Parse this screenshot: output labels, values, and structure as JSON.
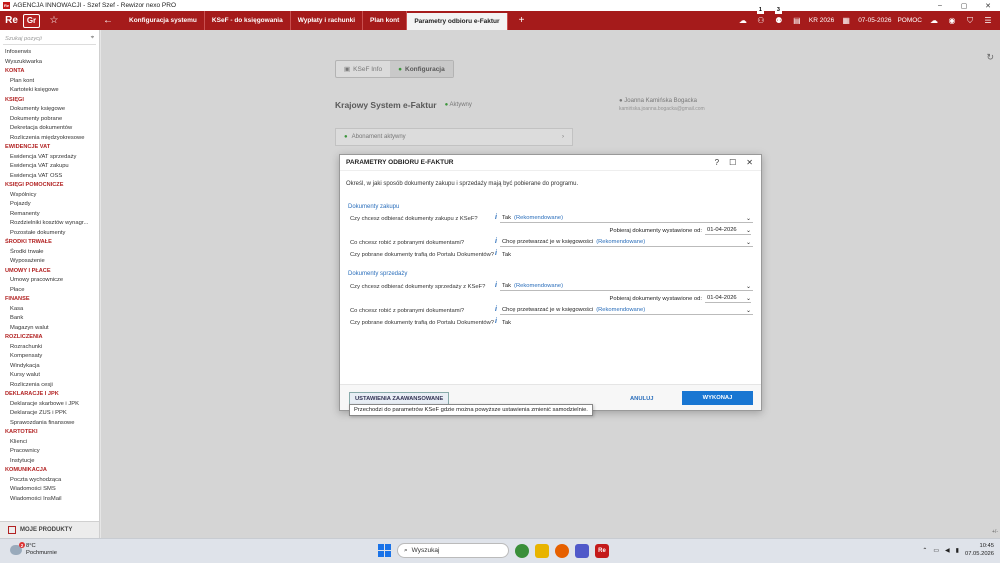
{
  "window": {
    "title": "AGENCJA INNOWACJI - Szef Szef - Rewizor nexo PRO",
    "icon_label": "Re",
    "minimize": "–",
    "maximize": "▢",
    "close": "✕"
  },
  "topbar": {
    "logo_re": "Re",
    "logo_gr": "Gr",
    "star": "☆",
    "back": "←",
    "tabs": [
      "Konfiguracja systemu",
      "KSeF - do księgowania",
      "Wypłaty i rachunki",
      "Plan kont",
      "Parametry odbioru e-Faktur"
    ],
    "active_tab_index": 4,
    "add_tab": "+",
    "badge1": "1",
    "badge2": "3",
    "year": "KR 2026",
    "date": "07-05-2026",
    "help": "POMOC",
    "menu_glyph": "☰"
  },
  "sidebar": {
    "search_placeholder": "Szukaj pozycji",
    "pin": "⌖",
    "top": [
      "Infoserwis",
      "Wyszukiwarka"
    ],
    "groups": [
      {
        "title": "KONTA",
        "items": [
          "Plan kont",
          "Kartoteki księgowe"
        ]
      },
      {
        "title": "KSIĘGI",
        "items": [
          "Dokumenty księgowe",
          "Dokumenty pobrane",
          "Dekretacja dokumentów",
          "Rozliczenia międzyokresowe"
        ]
      },
      {
        "title": "EWIDENCJE VAT",
        "items": [
          "Ewidencja VAT sprzedaży",
          "Ewidencja VAT zakupu",
          "Ewidencja VAT OSS"
        ]
      },
      {
        "title": "KSIĘGI POMOCNICZE",
        "items": [
          "Wspólnicy",
          "Pojazdy",
          "Remanenty",
          "Rozdzielniki kosztów wynagr...",
          "Pozostałe dokumenty"
        ]
      },
      {
        "title": "ŚRODKI TRWAŁE",
        "items": [
          "Środki trwałe",
          "Wyposażenie"
        ]
      },
      {
        "title": "UMOWY I PŁACE",
        "items": [
          "Umowy pracownicze",
          "Płace"
        ]
      },
      {
        "title": "FINANSE",
        "items": [
          "Kasa",
          "Bank",
          "Magazyn walut"
        ]
      },
      {
        "title": "ROZLICZENIA",
        "items": [
          "Rozrachunki",
          "Kompensaty",
          "Windykacja",
          "Kursy walut",
          "Rozliczenia cesji"
        ]
      },
      {
        "title": "DEKLARACJE I JPK",
        "items": [
          "Deklaracje skarbowe i JPK",
          "Deklaracje ZUS i PPK",
          "Sprawozdania finansowe"
        ]
      },
      {
        "title": "KARTOTEKI",
        "items": [
          "Klienci",
          "Pracownicy",
          "Instytucje"
        ]
      },
      {
        "title": "KOMUNIKACJA",
        "items": [
          "Poczta wychodząca",
          "Wiadomości SMS",
          "Wiadomości InsMail"
        ]
      }
    ],
    "footer": "MOJE PRODUKTY"
  },
  "background": {
    "tab_info": "KSeF Info",
    "tab_config": "Konfiguracja",
    "title": "Krajowy System e-Faktur",
    "status": "Aktywny",
    "user_name": "Joanna Kamińska Bogacka",
    "user_email": "kamińska.joanna.bogacka@gmail.com",
    "card": "Abonament aktywny",
    "chev": "›",
    "refresh": "↻"
  },
  "dialog": {
    "title": "PARAMETRY ODBIORU E-FAKTUR",
    "help": "?",
    "max": "☐",
    "close": "✕",
    "description": "Określ, w jaki sposób dokumenty zakupu i sprzedaży mają być pobierane do programu.",
    "info_glyph": "i",
    "dd_glyph": "⌄",
    "purchase": {
      "section": "Dokumenty zakupu",
      "q1": "Czy chcesz odbierać dokumenty zakupu z KSeF?",
      "a1": "Tak",
      "a1_rec": "(Rekomendowane)",
      "date_label": "Pobieraj dokumenty wystawione od:",
      "date_value": "01-04-2026",
      "q2": "Co chcesz robić z pobranymi dokumentami?",
      "a2": "Chcę przetwarzać je w księgowości",
      "a2_rec": "(Rekomendowane)",
      "q3": "Czy pobrane dokumenty trafią do Portalu Dokumentów?",
      "a3": "Tak"
    },
    "sales": {
      "section": "Dokumenty sprzedaży",
      "q1": "Czy chcesz odbierać dokumenty sprzedaży z KSeF?",
      "a1": "Tak",
      "a1_rec": "(Rekomendowane)",
      "date_label": "Pobieraj dokumenty wystawione od:",
      "date_value": "01-04-2026",
      "q2": "Co chcesz robić z pobranymi dokumentami?",
      "a2": "Chcę przetwarzać je w księgowości",
      "a2_rec": "(Rekomendowane)",
      "q3": "Czy pobrane dokumenty trafią do Portalu Dokumentów?",
      "a3": "Tak"
    },
    "advanced_button": "USTAWIENIA ZAAWANSOWANE",
    "cancel_button": "ANULUJ",
    "ok_button": "WYKONAJ",
    "tooltip": "Przechodzi do parametrów KSeF gdzie można powyższe ustawienia zmienić samodzielnie."
  },
  "taskbar": {
    "weather_badge": "2",
    "temp": "8°C",
    "weather": "Pochmurnie",
    "search": "Wyszukaj",
    "search_glyph": "⌕",
    "app_re": "Re",
    "tray_arrow": "⌃",
    "time": "10:45",
    "date": "07.05.2026",
    "corner": "+/-"
  },
  "colors": {
    "brand": "#a51b1b",
    "accent": "#1976d2",
    "link": "#2a6ebb"
  }
}
